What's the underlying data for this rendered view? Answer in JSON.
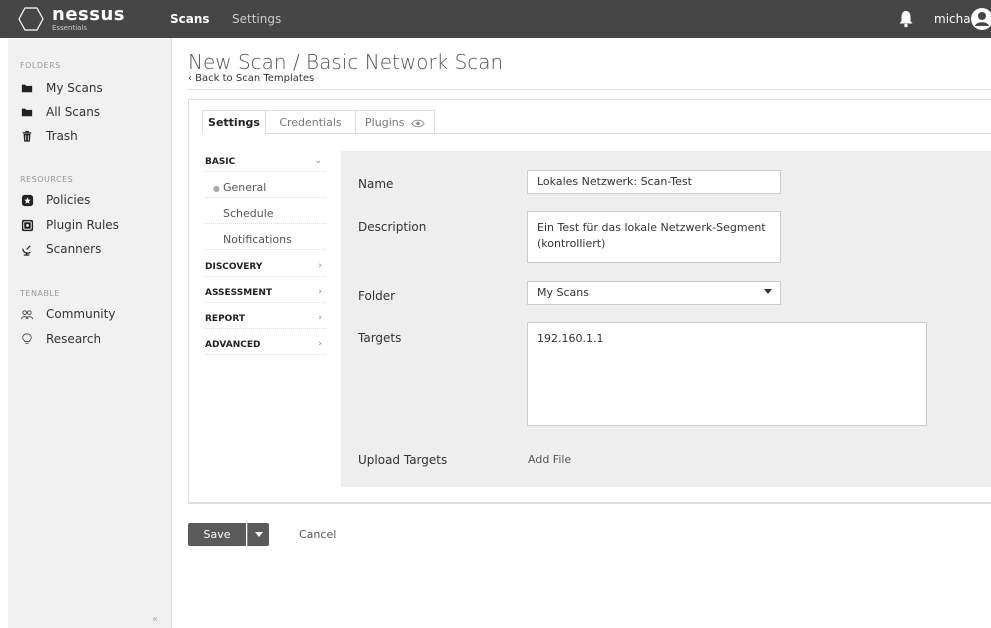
{
  "app": {
    "logo_name": "nessus",
    "logo_sub": "Essentials"
  },
  "topnav": {
    "scans": "Scans",
    "settings": "Settings",
    "user": "micha"
  },
  "sidebar": {
    "folders_heading": "FOLDERS",
    "folders": [
      {
        "label": "My Scans",
        "icon": "folder-icon"
      },
      {
        "label": "All Scans",
        "icon": "folder-icon"
      },
      {
        "label": "Trash",
        "icon": "trash-icon"
      }
    ],
    "resources_heading": "RESOURCES",
    "resources": [
      {
        "label": "Policies",
        "icon": "shield-icon"
      },
      {
        "label": "Plugin Rules",
        "icon": "plugin-icon"
      },
      {
        "label": "Scanners",
        "icon": "radar-icon"
      }
    ],
    "tenable_heading": "TENABLE",
    "tenable": [
      {
        "label": "Community",
        "icon": "people-icon"
      },
      {
        "label": "Research",
        "icon": "lightbulb-icon"
      }
    ],
    "collapse_label": "«"
  },
  "page": {
    "title": "New Scan / Basic Network Scan",
    "back": "‹ Back to Scan Templates"
  },
  "tabs": [
    {
      "label": "Settings",
      "active": true
    },
    {
      "label": "Credentials",
      "active": false
    },
    {
      "label": "Plugins",
      "active": false
    }
  ],
  "subnav": {
    "basic": "BASIC",
    "general": "General",
    "schedule": "Schedule",
    "notifications": "Notifications",
    "discovery": "DISCOVERY",
    "assessment": "ASSESSMENT",
    "report": "REPORT",
    "advanced": "ADVANCED"
  },
  "form": {
    "name_label": "Name",
    "name_value": "Lokales Netzwerk: Scan-Test",
    "description_label": "Description",
    "description_value": "Ein Test für das lokale Netzwerk-Segment (kontrolliert)",
    "folder_label": "Folder",
    "folder_value": "My Scans",
    "targets_label": "Targets",
    "targets_value": "192.160.1.1",
    "upload_label": "Upload Targets",
    "add_file": "Add File"
  },
  "actions": {
    "save": "Save",
    "cancel": "Cancel"
  },
  "colors": {
    "topbar": "#464646",
    "sidebar": "#f1f1f1",
    "form_bg": "#eeeeee",
    "button": "#5a5a5a"
  }
}
